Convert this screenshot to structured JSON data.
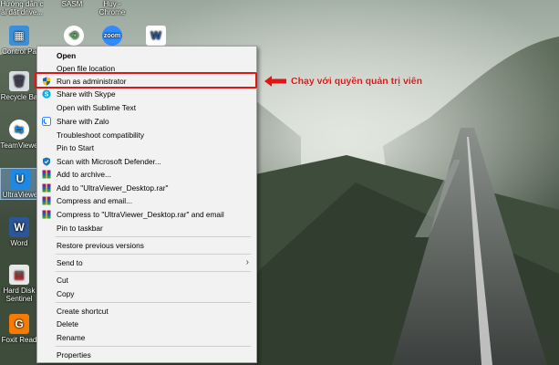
{
  "desktop_icons": {
    "top_labels": [
      "Hướng dẫn c",
      "ài đặt drive...",
      "SASM",
      "Huy -",
      "Chrome"
    ],
    "left_column": [
      {
        "label": "Control Pa",
        "icon": "control-panel-icon"
      },
      {
        "label": "Recycle Ba",
        "icon": "recycle-bin-icon"
      },
      {
        "label": "TeamViewe",
        "icon": "teamviewer-icon"
      },
      {
        "label": "UltraViewe",
        "icon": "ultraviewer-icon"
      },
      {
        "label": "Word",
        "icon": "word-icon"
      },
      {
        "label": "Hard Disk",
        "label2": "Sentinel",
        "icon": "hard-disk-sentinel-icon"
      },
      {
        "label": "Foxit Read",
        "icon": "foxit-reader-icon"
      }
    ],
    "top_row_icons": [
      "sasm-icon",
      "zoom-icon",
      "word-doc-icon"
    ]
  },
  "context_menu": {
    "items": [
      {
        "label": "Open",
        "bold": true
      },
      {
        "label": "Open file location"
      },
      {
        "label": "Run as administrator",
        "icon": "uac-shield-icon"
      },
      {
        "label": "Share with Skype",
        "icon": "skype-icon"
      },
      {
        "label": "Open with Sublime Text"
      },
      {
        "label": "Share with Zalo",
        "icon": "zalo-icon"
      },
      {
        "label": "Troubleshoot compatibility"
      },
      {
        "label": "Pin to Start"
      },
      {
        "label": "Scan with Microsoft Defender...",
        "icon": "defender-icon"
      },
      {
        "label": "Add to archive...",
        "icon": "winrar-icon"
      },
      {
        "label": "Add to \"UltraViewer_Desktop.rar\"",
        "icon": "winrar-icon"
      },
      {
        "label": "Compress and email...",
        "icon": "winrar-icon"
      },
      {
        "label": "Compress to \"UltraViewer_Desktop.rar\" and email",
        "icon": "winrar-icon"
      },
      {
        "label": "Pin to taskbar"
      },
      {
        "label": "Restore previous versions"
      },
      {
        "label": "Send to",
        "submenu": true
      },
      {
        "label": "Cut"
      },
      {
        "label": "Copy"
      },
      {
        "label": "Create shortcut"
      },
      {
        "label": "Delete"
      },
      {
        "label": "Rename"
      },
      {
        "label": "Properties"
      }
    ]
  },
  "annotation": {
    "text": "Chạy với quyền quản trị viên",
    "color": "#e21414"
  }
}
